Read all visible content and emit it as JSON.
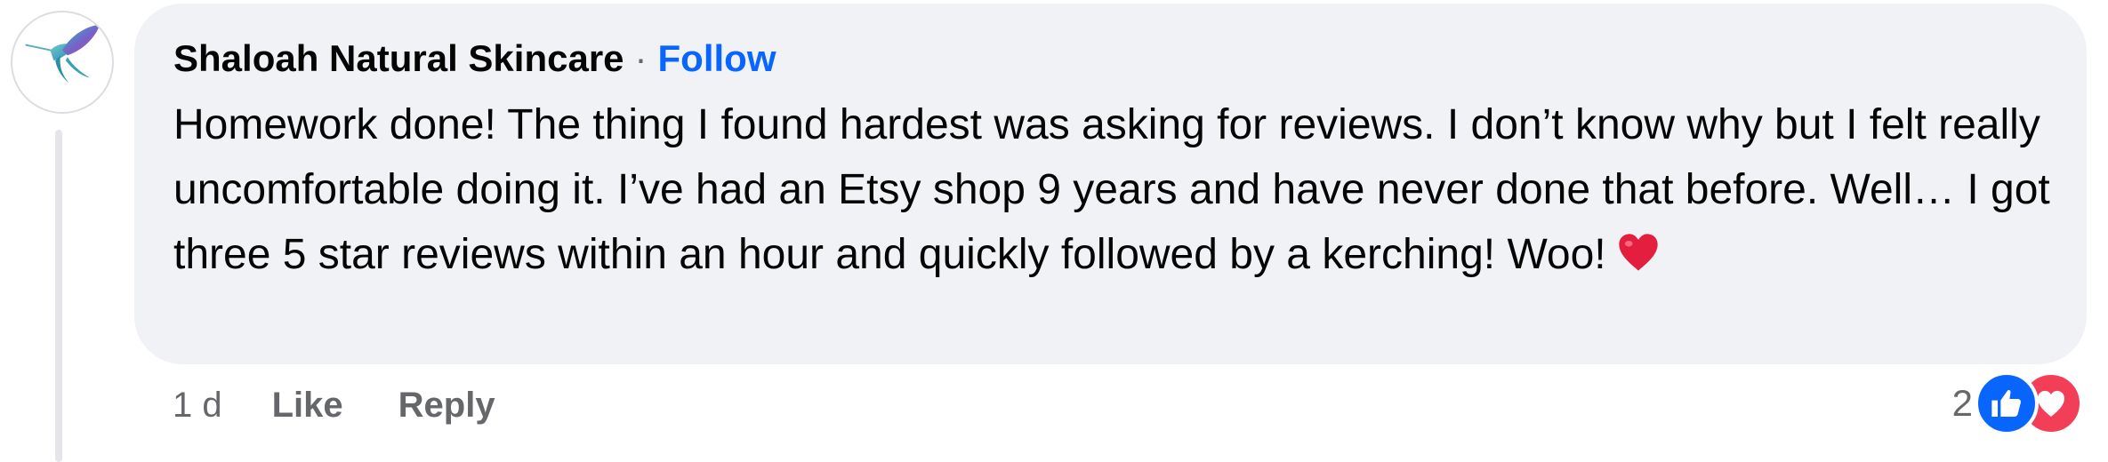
{
  "comment": {
    "author": "Shaloah Natural Skincare",
    "separator": "·",
    "follow_label": "Follow",
    "text": "Homework done! The thing I found hardest was asking for reviews. I don’t know why but I felt really uncomfortable doing it. I’ve had an Etsy shop 9 years and have never done that before. Well… I got three 5 star reviews within an hour and quickly followed by a kerching! Woo!",
    "emoji": "heart-emoji"
  },
  "actions": {
    "timestamp": "1 d",
    "like_label": "Like",
    "reply_label": "Reply"
  },
  "reactions": {
    "count": "2",
    "types": [
      "like",
      "love"
    ],
    "like_color": "#0866ff",
    "love_color": "#f33e58"
  },
  "colors": {
    "bubble_bg": "#f0f2f5",
    "link_blue": "#0866ff",
    "secondary_text": "#65676b"
  }
}
